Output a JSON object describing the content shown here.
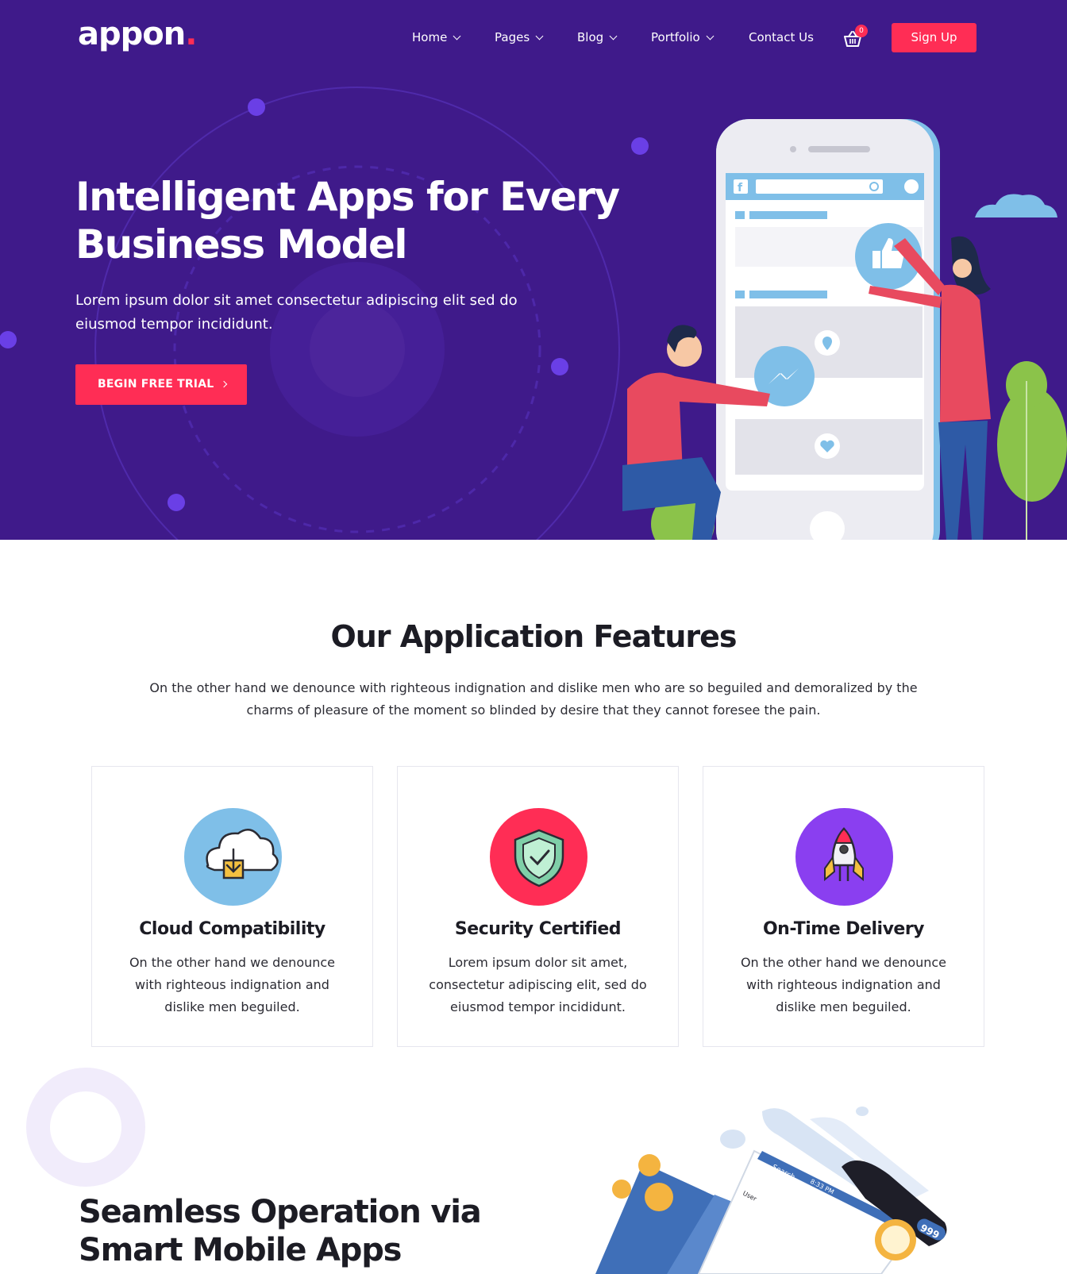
{
  "brand": {
    "name": "appon",
    "dot": ".",
    "accent_color": "#ff2d55",
    "hero_bg": "#3f1a8a"
  },
  "nav": {
    "items": [
      {
        "label": "Home",
        "has_dropdown": true
      },
      {
        "label": "Pages",
        "has_dropdown": true
      },
      {
        "label": "Blog",
        "has_dropdown": true
      },
      {
        "label": "Portfolio",
        "has_dropdown": true
      },
      {
        "label": "Contact Us",
        "has_dropdown": false
      }
    ],
    "cart_icon": "shopping-basket-icon",
    "cart_count": "0",
    "signup_label": "Sign Up"
  },
  "hero": {
    "title_line1": "Intelligent Apps for Every",
    "title_line2": "Business Model",
    "subtitle": "Lorem ipsum dolor sit amet consectetur adipiscing elit sed do eiusmod tempor incididunt.",
    "cta_label": "BEGIN FREE TRIAL",
    "cta_icon": "chevron-right-icon"
  },
  "features": {
    "title": "Our Application Features",
    "subtitle": "On the other hand we denounce with righteous indignation and dislike men who are so beguiled and demoralized by the charms of pleasure of the moment so blinded by desire that they cannot foresee the pain.",
    "cards": [
      {
        "title": "Cloud Compatibility",
        "text": "On the other hand we denounce with righteous indignation and dislike men beguiled.",
        "icon": "cloud-download-icon",
        "color": "#7fbfe8"
      },
      {
        "title": "Security Certified",
        "text": "Lorem ipsum dolor sit amet, consectetur adipiscing elit, sed do eiusmod tempor incididunt.",
        "icon": "shield-check-icon",
        "color": "#ff2d55"
      },
      {
        "title": "On-Time Delivery",
        "text": "On the other hand we denounce with righteous indignation and dislike men beguiled.",
        "icon": "rocket-icon",
        "color": "#8a3ff0"
      }
    ]
  },
  "seamless": {
    "title_line1": "Seamless Operation via",
    "title_line2": "Smart Mobile Apps"
  },
  "illustration_text": {
    "search": "Search",
    "time": "8:33 PM",
    "user": "User",
    "badge": "999"
  }
}
